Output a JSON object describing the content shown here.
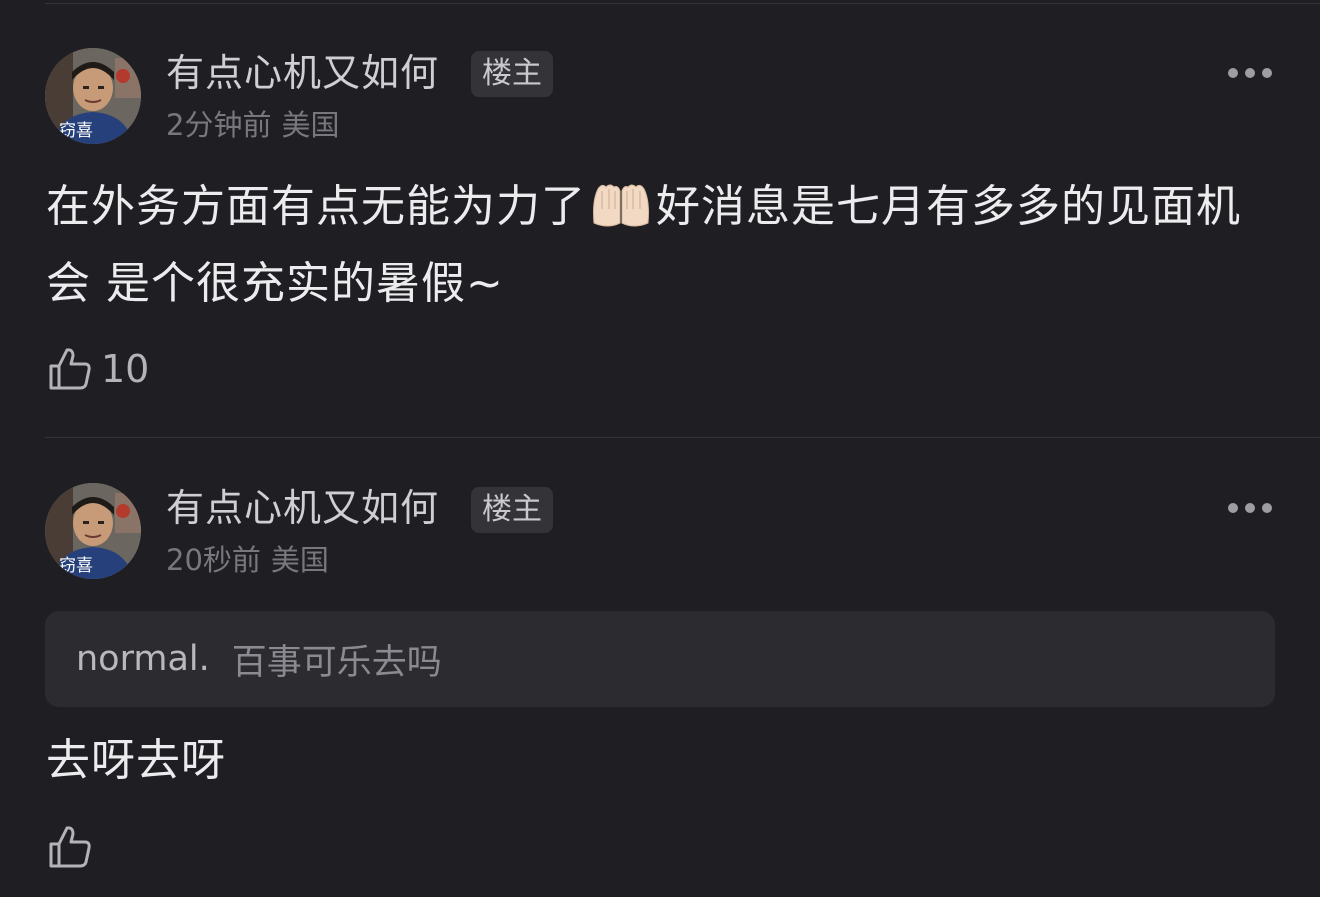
{
  "comments": [
    {
      "username": "有点心机又如何",
      "badge": "楼主",
      "time": "2分钟前",
      "location": "美国",
      "avatar_caption": "窃喜",
      "text_before_emoji": "在外务方面有点无能为力了",
      "emoji": "raised-hands-emoji",
      "text_after_emoji": "好消息是七月有多多的见面机会 是个很充实的暑假~",
      "likes": "10"
    },
    {
      "username": "有点心机又如何",
      "badge": "楼主",
      "time": "20秒前",
      "location": "美国",
      "avatar_caption": "窃喜",
      "quote": {
        "author": "normal.",
        "text": "百事可乐去吗"
      },
      "text": "去呀去呀",
      "likes": ""
    }
  ],
  "icons": {
    "more": "more-horizontal-icon",
    "like": "thumbs-up-icon"
  },
  "colors": {
    "background": "#1f1f23",
    "badge_bg": "#333338",
    "quote_bg": "#2b2b30"
  }
}
